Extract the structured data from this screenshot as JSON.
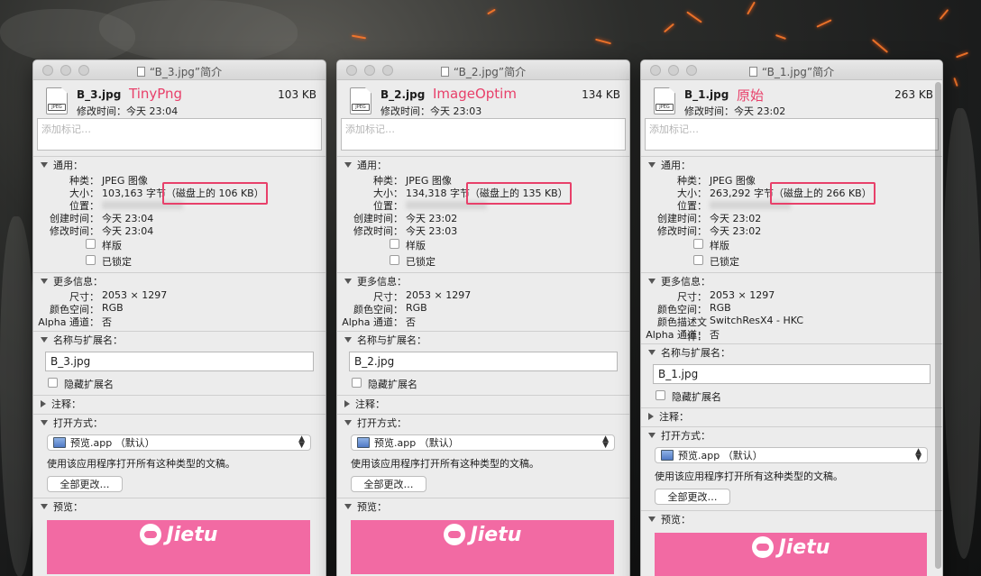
{
  "windows": [
    {
      "title": "“B_3.jpg”简介",
      "filename": "B_3.jpg",
      "tool": "TinyPng",
      "size": "103 KB",
      "modified": "修改时间：今天 23:04",
      "notes_placeholder": "添加标记…",
      "general": {
        "header": "通用：",
        "kind_label": "种类：",
        "kind": "JPEG 图像",
        "size_label": "大小：",
        "size_bytes": "103,163 字节",
        "size_disk": "（磁盘上的 106 KB）",
        "where_label": "位置：",
        "created_label": "创建时间：",
        "created": "今天 23:04",
        "modified_label": "修改时间：",
        "modified": "今天 23:04",
        "stationery": "样版",
        "locked": "已锁定"
      },
      "more": {
        "header": "更多信息：",
        "rows": [
          {
            "k": "尺寸：",
            "v": "2053 × 1297"
          },
          {
            "k": "颜色空间：",
            "v": "RGB"
          },
          {
            "k": "Alpha 通道：",
            "v": "否"
          }
        ]
      },
      "name_ext": {
        "header": "名称与扩展名：",
        "value": "B_3.jpg",
        "hide_ext": "隐藏扩展名"
      },
      "comments": "注释：",
      "open_with": {
        "header": "打开方式：",
        "app": "预览.app （默认）",
        "desc": "使用该应用程序打开所有这种类型的文稿。",
        "change_all": "全部更改…"
      },
      "preview": {
        "header": "预览：",
        "brand": "Jietu"
      }
    },
    {
      "title": "“B_2.jpg”简介",
      "filename": "B_2.jpg",
      "tool": "ImageOptim",
      "size": "134 KB",
      "modified": "修改时间：今天 23:03",
      "notes_placeholder": "添加标记…",
      "general": {
        "header": "通用：",
        "kind_label": "种类：",
        "kind": "JPEG 图像",
        "size_label": "大小：",
        "size_bytes": "134,318 字节",
        "size_disk": "（磁盘上的 135 KB）",
        "where_label": "位置：",
        "created_label": "创建时间：",
        "created": "今天 23:02",
        "modified_label": "修改时间：",
        "modified": "今天 23:03",
        "stationery": "样版",
        "locked": "已锁定"
      },
      "more": {
        "header": "更多信息：",
        "rows": [
          {
            "k": "尺寸：",
            "v": "2053 × 1297"
          },
          {
            "k": "颜色空间：",
            "v": "RGB"
          },
          {
            "k": "Alpha 通道：",
            "v": "否"
          }
        ]
      },
      "name_ext": {
        "header": "名称与扩展名：",
        "value": "B_2.jpg",
        "hide_ext": "隐藏扩展名"
      },
      "comments": "注释：",
      "open_with": {
        "header": "打开方式：",
        "app": "预览.app （默认）",
        "desc": "使用该应用程序打开所有这种类型的文稿。",
        "change_all": "全部更改…"
      },
      "preview": {
        "header": "预览：",
        "brand": "Jietu"
      }
    },
    {
      "title": "“B_1.jpg”简介",
      "filename": "B_1.jpg",
      "tool": "原始",
      "size": "263 KB",
      "modified": "修改时间：今天 23:02",
      "notes_placeholder": "添加标记…",
      "general": {
        "header": "通用：",
        "kind_label": "种类：",
        "kind": "JPEG 图像",
        "size_label": "大小：",
        "size_bytes": "263,292 字节",
        "size_disk": "（磁盘上的 266 KB）",
        "where_label": "位置：",
        "created_label": "创建时间：",
        "created": "今天 23:02",
        "modified_label": "修改时间：",
        "modified": "今天 23:02",
        "stationery": "样版",
        "locked": "已锁定"
      },
      "more": {
        "header": "更多信息：",
        "rows": [
          {
            "k": "尺寸：",
            "v": "2053 × 1297"
          },
          {
            "k": "颜色空间：",
            "v": "RGB"
          },
          {
            "k": "颜色描述文件：",
            "v": "SwitchResX4 - HKC"
          },
          {
            "k": "Alpha 通道：",
            "v": "否"
          }
        ]
      },
      "name_ext": {
        "header": "名称与扩展名：",
        "value": "B_1.jpg",
        "hide_ext": "隐藏扩展名"
      },
      "comments": "注释：",
      "open_with": {
        "header": "打开方式：",
        "app": "预览.app （默认）",
        "desc": "使用该应用程序打开所有这种类型的文稿。",
        "change_all": "全部更改…"
      },
      "preview": {
        "header": "预览：",
        "brand": "Jietu"
      }
    }
  ],
  "colors": {
    "highlight": "#e8406a",
    "preview_bg": "#f26aa3",
    "window_bg": "#ececec"
  }
}
